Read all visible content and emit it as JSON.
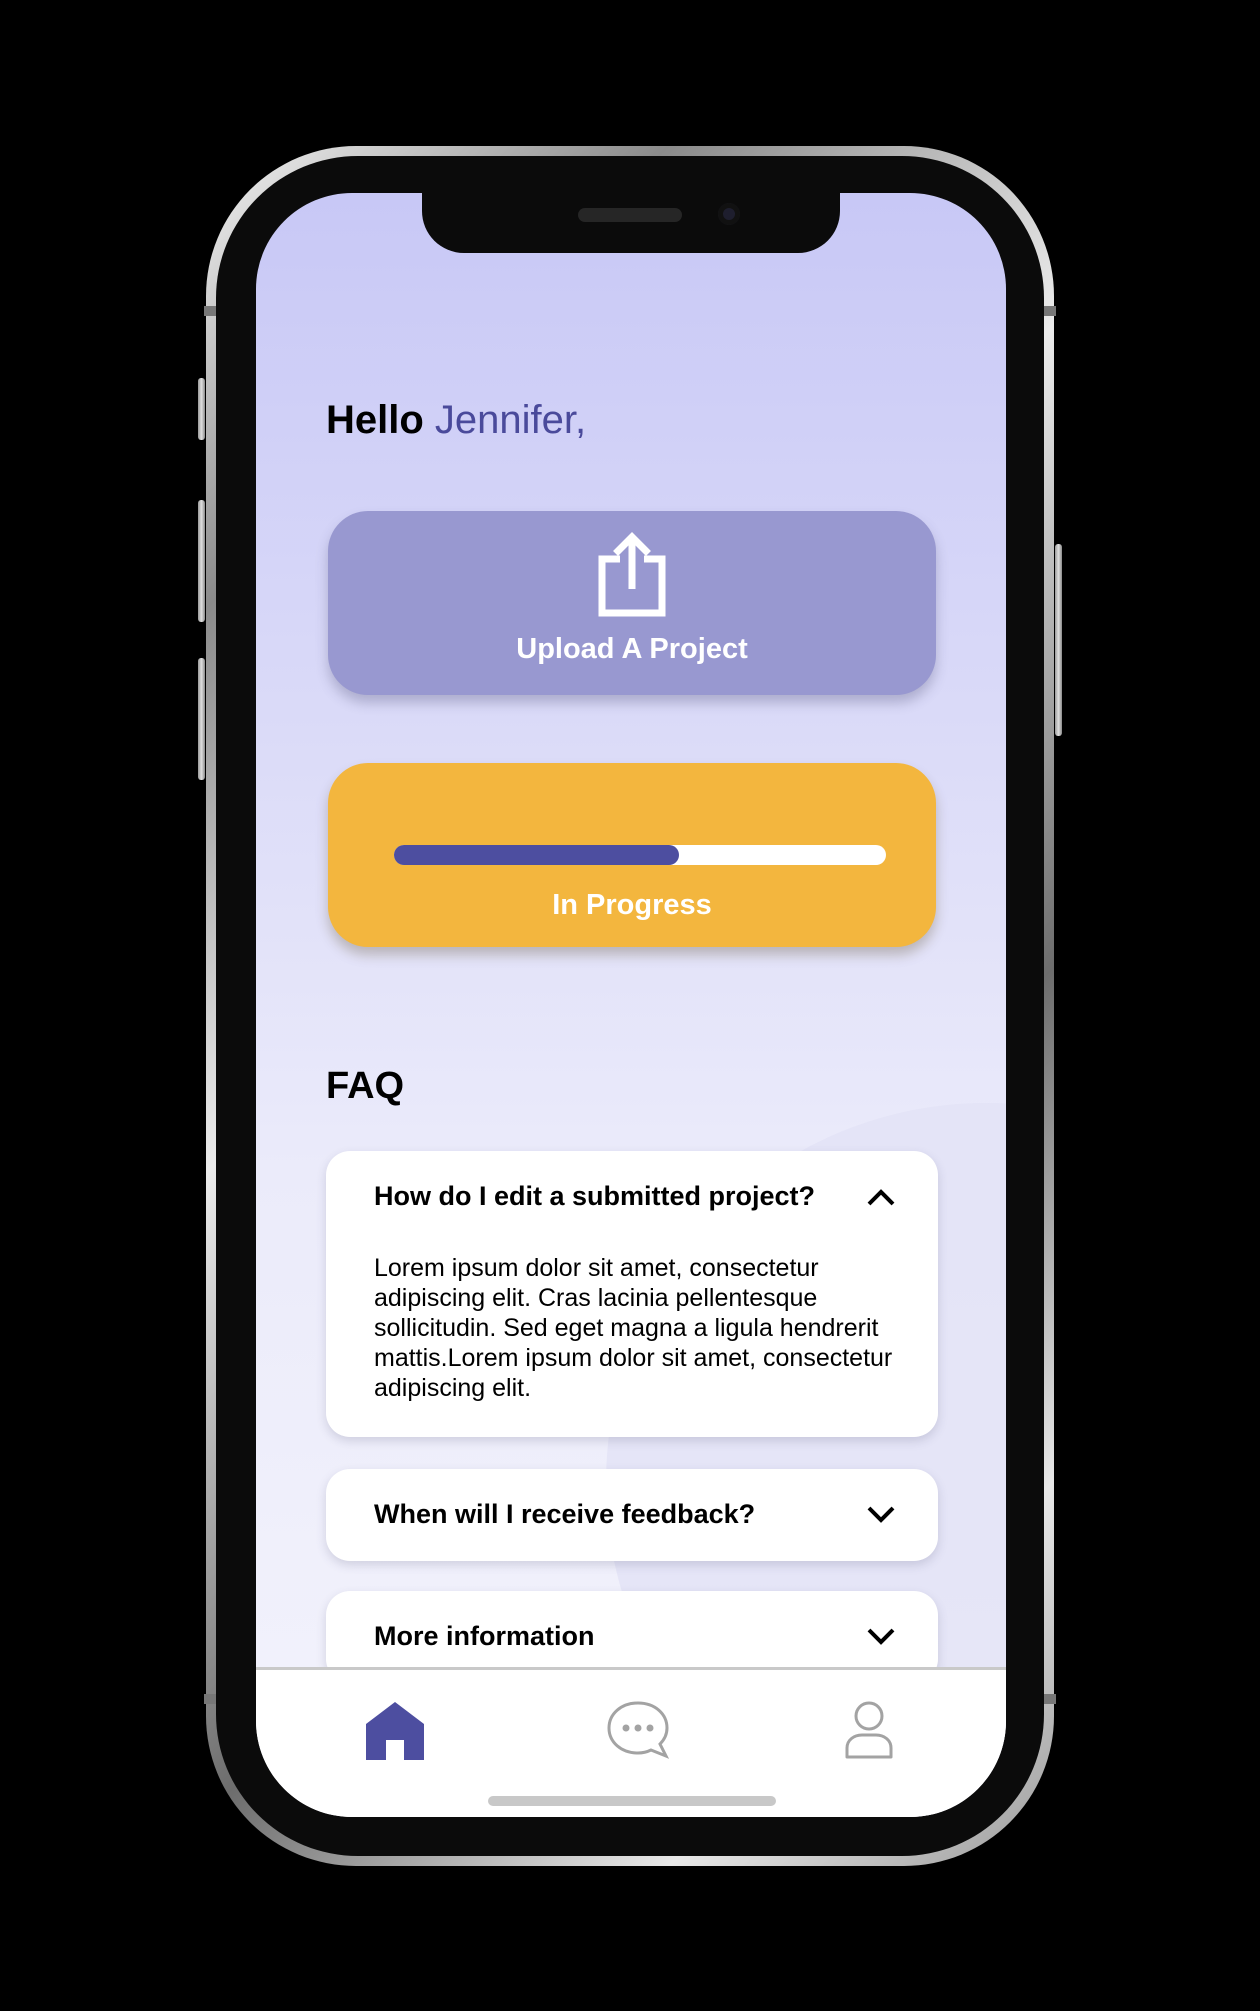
{
  "greeting": {
    "hello": "Hello",
    "name": "Jennifer,"
  },
  "upload": {
    "label": "Upload A Project",
    "icon": "share-upload-icon"
  },
  "progress": {
    "label": "In Progress",
    "fraction": 0.58
  },
  "faq": {
    "title": "FAQ",
    "items": [
      {
        "question": "How do I edit a submitted project?",
        "answer": "Lorem ipsum dolor sit amet, consectetur adipiscing elit. Cras lacinia pellentesque sollicitudin. Sed eget magna a ligula hendrerit mattis.Lorem ipsum dolor sit amet, consectetur adipiscing elit.",
        "expanded": true
      },
      {
        "question": "When will I receive feedback?",
        "expanded": false
      },
      {
        "question": "More information",
        "expanded": false
      }
    ]
  },
  "tabbar": {
    "items": [
      {
        "icon": "home-icon",
        "active": true
      },
      {
        "icon": "chat-bubble-icon",
        "active": false
      },
      {
        "icon": "user-profile-icon",
        "active": false
      }
    ]
  },
  "colors": {
    "accent": "#4d4ea0",
    "upload_card": "#9898d0",
    "progress_card": "#f3b63e",
    "name_text": "#4a4a9b"
  }
}
